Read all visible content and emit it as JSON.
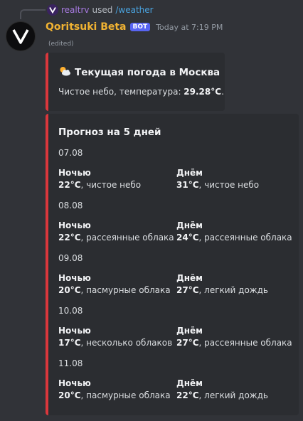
{
  "reply": {
    "user": "realtrv",
    "used": "used",
    "command": "/weather"
  },
  "message": {
    "author": "Qoritsuki Beta",
    "badge": "BOT",
    "timestamp": "Today at 7:19 PM",
    "edited": "(edited)"
  },
  "current": {
    "icon": "sun-behind-cloud-icon",
    "title": "Текущая погода в Москва",
    "desc_prefix": "Чистое небо, температура: ",
    "temp": "29.28°C",
    "desc_suffix": "."
  },
  "forecast": {
    "title": "Прогноз на 5 дней",
    "days": [
      {
        "date": "07.08",
        "night_label": "Ночью",
        "night_temp": "22°C",
        "night_desc": ", чистое небо",
        "day_label": "Днём",
        "day_temp": "31°C",
        "day_desc": ", чистое небо"
      },
      {
        "date": "08.08",
        "night_label": "Ночью",
        "night_temp": "22°C",
        "night_desc": ", рассеянные облака",
        "day_label": "Днём",
        "day_temp": "24°C",
        "day_desc": ", рассеянные облака"
      },
      {
        "date": "09.08",
        "night_label": "Ночью",
        "night_temp": "20°C",
        "night_desc": ", пасмурные облака",
        "day_label": "Днём",
        "day_temp": "27°C",
        "day_desc": ", легкий дождь"
      },
      {
        "date": "10.08",
        "night_label": "Ночью",
        "night_temp": "17°C",
        "night_desc": ", несколько облаков",
        "day_label": "Днём",
        "day_temp": "27°C",
        "day_desc": ", рассеянные облака"
      },
      {
        "date": "11.08",
        "night_label": "Ночью",
        "night_temp": "20°C",
        "night_desc": ", пасмурные облака",
        "day_label": "Днём",
        "day_temp": "22°C",
        "day_desc": ", легкий дождь"
      }
    ]
  },
  "colors": {
    "accent": "#da373c",
    "bot_name": "#f0b232",
    "badge": "#5865f2",
    "command": "#4aa3df",
    "reply_user": "#a77ae0"
  }
}
